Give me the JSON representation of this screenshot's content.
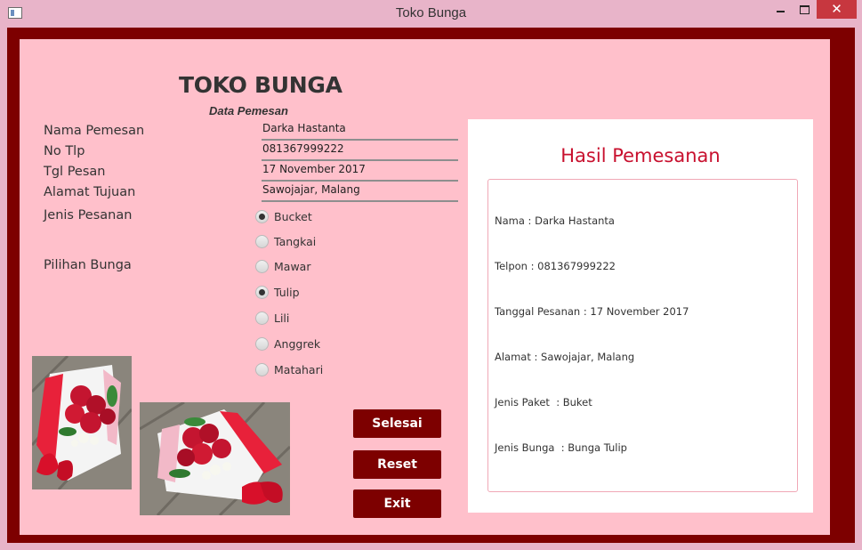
{
  "window": {
    "title": "Toko Bunga",
    "close_glyph": "✕"
  },
  "form": {
    "heading": "TOKO BUNGA",
    "subheading": "Data Pemesan",
    "labels": {
      "nama": "Nama Pemesan",
      "telp": "No Tlp",
      "tgl": "Tgl Pesan",
      "alamat": "Alamat Tujuan",
      "jenis": "Jenis Pesanan",
      "pilihan": "Pilihan Bunga"
    },
    "fields": {
      "nama": "Darka Hastanta",
      "telp": "081367999222",
      "tgl": "17 November 2017",
      "alamat": "Sawojajar, Malang"
    },
    "jenis_options": [
      {
        "label": "Bucket",
        "selected": true
      },
      {
        "label": "Tangkai",
        "selected": false
      }
    ],
    "bunga_options": [
      {
        "label": "Mawar",
        "selected": false
      },
      {
        "label": "Tulip",
        "selected": true
      },
      {
        "label": "Lili",
        "selected": false
      },
      {
        "label": "Anggrek",
        "selected": false
      },
      {
        "label": "Matahari",
        "selected": false
      }
    ],
    "buttons": {
      "selesai": "Selesai",
      "reset": "Reset",
      "exit": "Exit"
    }
  },
  "result": {
    "title": "Hasil Pemesanan",
    "lines": [
      "Nama : Darka Hastanta",
      "Telpon : 081367999222",
      "Tanggal Pesanan : 17 November 2017",
      "Alamat : Sawojajar, Malang",
      "Jenis Paket  : Buket",
      "Jenis Bunga  : Bunga Tulip"
    ]
  },
  "colors": {
    "accent": "#7d0000",
    "panel": "#ffc0cb",
    "result_title": "#c8102e"
  }
}
